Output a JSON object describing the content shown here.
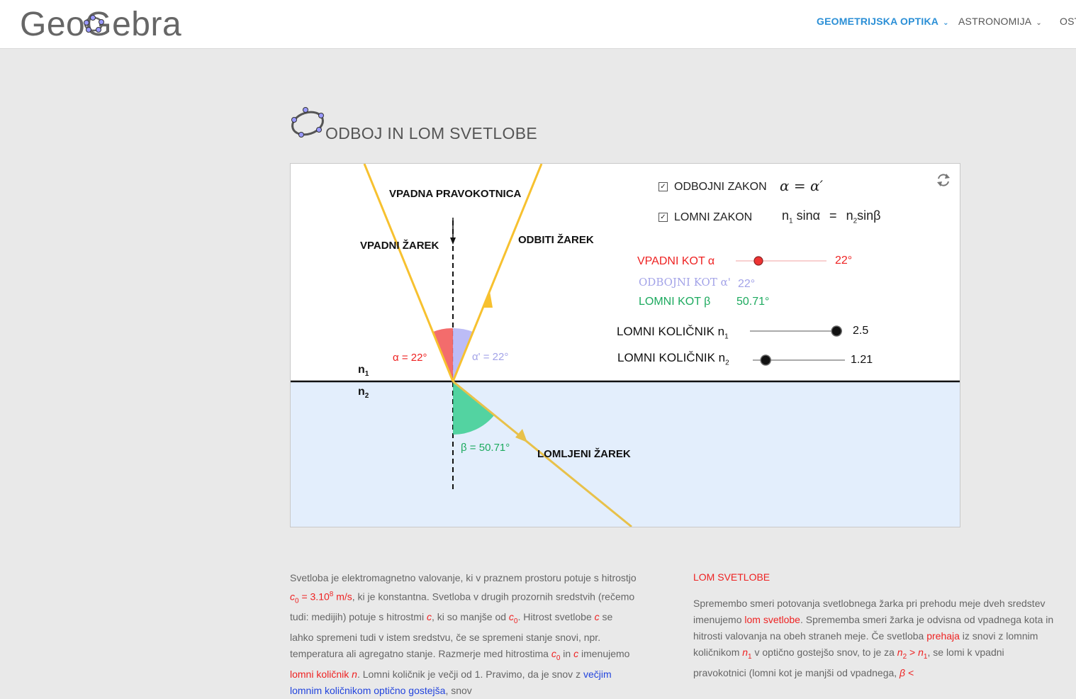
{
  "header": {
    "logo_text": "GeoGebra",
    "nav": [
      {
        "label": "GEOMETRIJSKA OPTIKA",
        "active": true
      },
      {
        "label": "ASTRONOMIJA",
        "active": false
      },
      {
        "label": "OST",
        "active": false
      }
    ]
  },
  "page": {
    "title": "ODBOJ IN LOM SVETLOBE"
  },
  "applet": {
    "perp_label": "VPADNA PRAVOKOTNICA",
    "incident_ray_label": "VPADNI ŽAREK",
    "reflected_ray_label": "ODBITI ŽAREK",
    "refracted_ray_label": "LOMLJENI ŽAREK",
    "n1_label": "n",
    "n1_sub": "1",
    "n2_label": "n",
    "n2_sub": "2",
    "alpha_angle_label": "α = 22°",
    "alpha_prime_angle_label": "α' = 22°",
    "beta_angle_label": "β = 50.71°",
    "law_reflection": {
      "checked": true,
      "label": "ODBOJNI ZAKON",
      "formula": "α = α′"
    },
    "law_refraction": {
      "checked": true,
      "label": "LOMNI ZAKON",
      "formula_left_n": "n",
      "formula_left_sub": "1",
      "formula_left_fn": "sinα",
      "formula_eq": "=",
      "formula_right_n": "n",
      "formula_right_sub": "2",
      "formula_right_fn": "sinβ"
    },
    "incident_angle": {
      "label": "VPADNI KOT α",
      "value": "22°",
      "slider_fraction": 0.25
    },
    "reflected_angle": {
      "label": "ODBOJNI KOT α'",
      "value": "22°"
    },
    "refracted_angle": {
      "label": "LOMNI KOT β",
      "value": "50.71°"
    },
    "n1_slider": {
      "label": "LOMNI KOLIČNIK n",
      "sub": "1",
      "value": "2.5",
      "slider_fraction": 0.94
    },
    "n2_slider": {
      "label": "LOMNI KOLIČNIK n",
      "sub": "2",
      "value": "1.21",
      "slider_fraction": 0.14
    },
    "refresh_icon": "refresh-icon",
    "colors": {
      "ray": "#f7c12f",
      "ray_refracted": "#e8c14a",
      "alpha": "#f26464",
      "alpha_prime": "#b3b3f3",
      "beta": "#2ecc8a",
      "medium2": "#e3eefc",
      "label_red": "#e22",
      "label_violet": "#a3a3e8",
      "label_green": "#1daa5f"
    }
  },
  "text_left": {
    "p1_a": "Svetloba je elektromagnetno valovanje, ki v praznem prostoru potuje s hitrostjo ",
    "c0_c": "c",
    "c0_sub": "0",
    "c0_val": " = 3.10",
    "c0_sup": "8",
    "c0_unit": " m/s",
    "p1_b": ", ki je konstantna. Svetloba v drugih prozornih sredstvih (rečemo tudi: medijih) potuje s hitrostmi ",
    "c_sym": "c",
    "p1_c": ", ki so manjše od ",
    "c0b_c": "c",
    "c0b_sub": "0",
    "p1_d": ". Hitrost svetlobe ",
    "c_sym2": "c",
    "p1_e": " se lahko spremeni tudi v istem sredstvu, če se spremeni stanje snovi, npr. temperatura ali agregatno stanje. Razmerje med hitrostima  ",
    "c0c_c": "c",
    "c0c_sub": "0",
    "p1_f": " in  ",
    "c_sym3": "c",
    "p1_g": " imenujemo ",
    "lomni_kolicnik": "lomni količnik ",
    "n_sym": "n",
    "p1_h": ". Lomni količnik je večji od 1. Pravimo, da je snov z ",
    "vecjim": "večjim lomnim količnikom optično gostejša",
    "p1_i": ", snov"
  },
  "text_right": {
    "heading": "LOM SVETLOBE",
    "p_a": "Spremembo smeri potovanja svetlobnega žarka pri prehodu meje dveh sredstev imenujemo ",
    "lom_svetlobe": "lom svetlobe",
    "p_b": ". Sprememba smeri žarka je odvisna od vpadnega kota in hitrosti valovanja na obeh straneh meje. Če svetloba ",
    "prehaja": "prehaja",
    "p_c": " iz snovi z lomnim količnikom ",
    "n1": "n",
    "n1_sub": "1",
    "p_d": " v optično gostejšo snov, to je za ",
    "n2b": "n",
    "n2b_sub": "2",
    "gt": " > ",
    "n1b": "n",
    "n1b_sub": "1",
    "p_e": ", se lomi k vpadni pravokotnici (lomni kot je manjši od vpadnega, ",
    "beta_lt": "β <"
  }
}
